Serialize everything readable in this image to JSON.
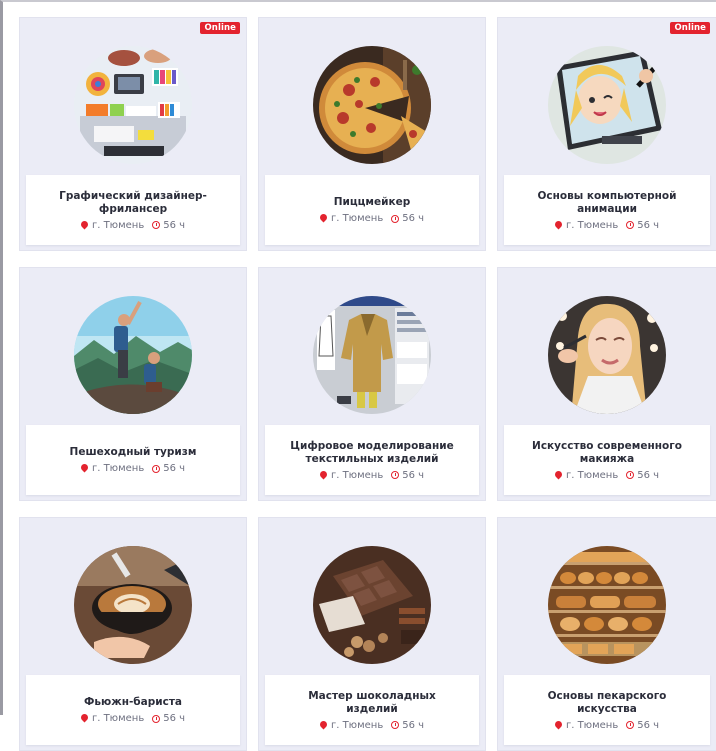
{
  "badge_label": "Online",
  "colors": {
    "badge": "#e3232e",
    "card_bg": "#ebecf6",
    "title": "#2b2d3a",
    "meta": "#6e7080"
  },
  "courses": [
    {
      "title": "Графический дизайнер-фрилансер",
      "city": "г. Тюмень",
      "hours": "56 ч",
      "online": true,
      "image": "designer-desk-photo"
    },
    {
      "title": "Пиццмейкер",
      "city": "г. Тюмень",
      "hours": "56 ч",
      "online": false,
      "image": "pizza-photo"
    },
    {
      "title": "Основы компьютерной анимации",
      "city": "г. Тюмень",
      "hours": "56 ч",
      "online": true,
      "image": "anime-tablet-photo"
    },
    {
      "title": "Пешеходный туризм",
      "city": "г. Тюмень",
      "hours": "56 ч",
      "online": false,
      "image": "hikers-mountains-photo"
    },
    {
      "title": "Цифровое моделирование текстильных изделий",
      "city": "г. Тюмень",
      "hours": "56 ч",
      "online": false,
      "image": "3d-jacket-cad-photo"
    },
    {
      "title": "Искусство современного макияжа",
      "city": "г. Тюмень",
      "hours": "56 ч",
      "online": false,
      "image": "makeup-model-photo"
    },
    {
      "title": "Фьюжн-бариста",
      "city": "г. Тюмень",
      "hours": "56 ч",
      "online": false,
      "image": "latte-art-photo"
    },
    {
      "title": "Мастер шоколадных изделий",
      "city": "г. Тюмень",
      "hours": "56 ч",
      "online": false,
      "image": "chocolate-photo"
    },
    {
      "title": "Основы пекарского искусства",
      "city": "г. Тюмень",
      "hours": "56 ч",
      "online": false,
      "image": "bakery-shelves-photo"
    }
  ]
}
